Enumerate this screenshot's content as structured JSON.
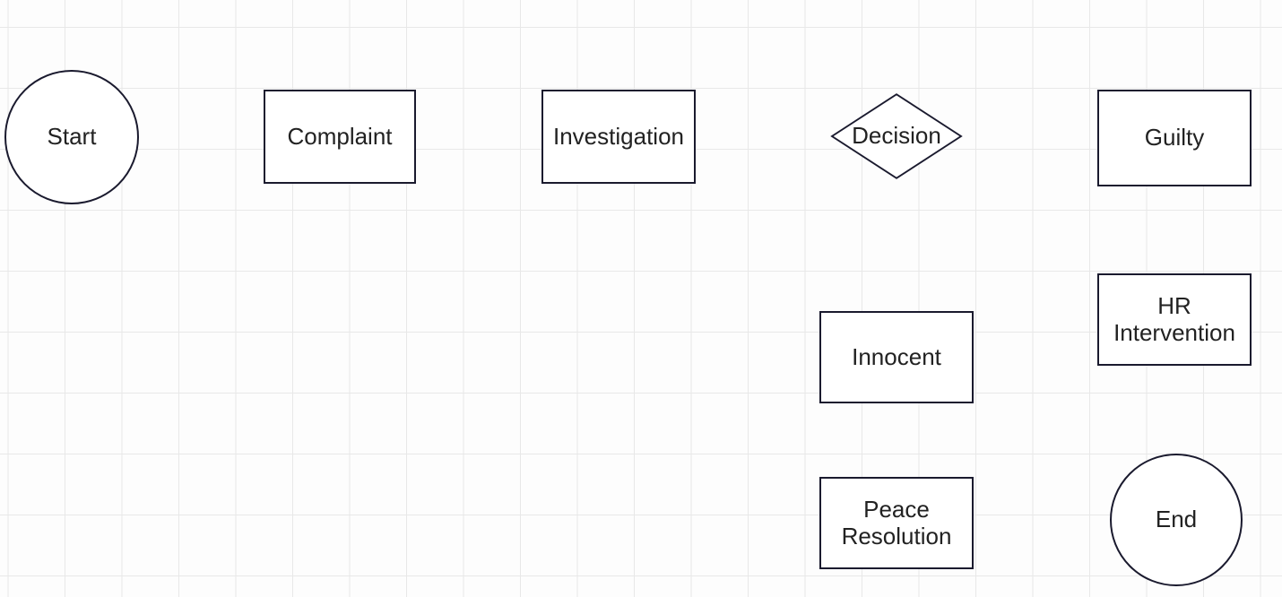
{
  "nodes": {
    "start": {
      "label": "Start",
      "type": "terminator"
    },
    "complaint": {
      "label": "Complaint",
      "type": "process"
    },
    "investigation": {
      "label": "Investigation",
      "type": "process"
    },
    "decision": {
      "label": "Decision",
      "type": "decision"
    },
    "guilty": {
      "label": "Guilty",
      "type": "process"
    },
    "innocent": {
      "label": "Innocent",
      "type": "process"
    },
    "hr_intervention": {
      "label": "HR Intervention",
      "type": "process"
    },
    "peace_resolution": {
      "label": "Peace Resolution",
      "type": "process"
    },
    "end": {
      "label": "End",
      "type": "terminator"
    }
  }
}
